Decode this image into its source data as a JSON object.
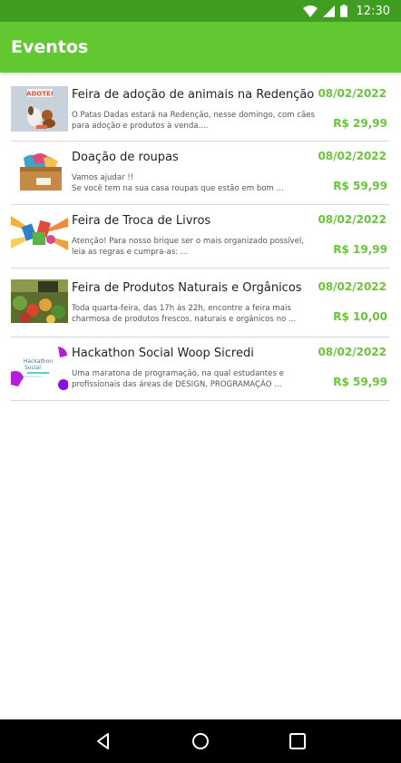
{
  "status_bar": {
    "time": "12:30",
    "icons": [
      "wifi-icon",
      "signal-icon",
      "battery-icon"
    ]
  },
  "app_bar": {
    "title": "Eventos"
  },
  "colors": {
    "status_bar": "#3f9d1f",
    "app_bar": "#62c832",
    "accent_green": "#6ac43a",
    "nav_bar": "#000000"
  },
  "events": [
    {
      "title": "Feira de adoção de animais na Redenção",
      "date": "08/02/2022",
      "desc_line1": "O Patas Dadas estará na Redenção, nesse domingo, com cães",
      "desc_line2": "para adoção e produtos à venda....",
      "price": "R$ 29,99",
      "thumb_text": "ADOTE!"
    },
    {
      "title": "Doação de roupas",
      "date": "08/02/2022",
      "desc_line1": "Vamos ajudar !!",
      "desc_line2": "Se você tem na sua casa roupas que estão em bom ...",
      "price": "R$ 59,99"
    },
    {
      "title": "Feira de Troca de Livros",
      "date": "08/02/2022",
      "desc_line1": "Atenção! Para nosso brique ser o mais organizado possível,",
      "desc_line2": "leia as regras e cumpra-as: ...",
      "price": "R$ 19,99"
    },
    {
      "title": "Feira de Produtos Naturais e Orgânicos",
      "date": "08/02/2022",
      "desc_line1": "Toda quarta-feira, das 17h às 22h, encontre a feira mais",
      "desc_line2": "charmosa de produtos frescos, naturais e orgânicos no ...",
      "price": "R$ 10,00"
    },
    {
      "title": "Hackathon Social Woop Sicredi",
      "date": "08/02/2022",
      "desc_line1": "Uma maratona de programação, na qual estudantes e",
      "desc_line2": "profissionais das áreas de DESIGN, PROGRAMAÇÃO ...",
      "price": "R$ 59,99",
      "thumb_text_1": "Hackathon",
      "thumb_text_2": "Social"
    }
  ],
  "nav_bar": {
    "buttons": [
      "back-icon",
      "home-icon",
      "recents-icon"
    ]
  }
}
